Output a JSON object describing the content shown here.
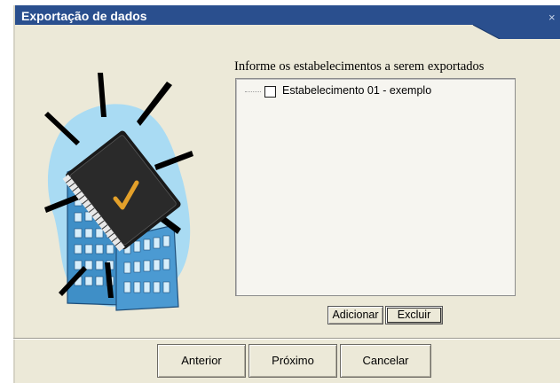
{
  "window": {
    "title": "Exportação de dados",
    "close_glyph": "×"
  },
  "illustration": {
    "icon": "building-with-checked-book-icon"
  },
  "establishments": {
    "label": "Informe os estabelecimentos a serem exportados",
    "items": [
      {
        "label": "Estabelecimento 01  - exemplo",
        "checked": false
      }
    ]
  },
  "list_actions": {
    "add_label": "Adicionar",
    "remove_label": "Excluir"
  },
  "footer": {
    "back_label": "Anterior",
    "next_label": "Próximo",
    "cancel_label": "Cancelar"
  },
  "colors": {
    "titlebar": "#2a4f8e",
    "window_bg": "#ece9d8",
    "list_bg": "#f6f5f0"
  }
}
